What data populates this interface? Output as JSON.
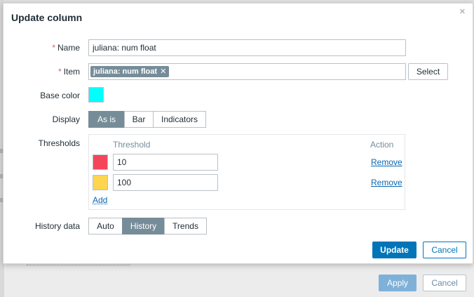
{
  "dialog": {
    "title": "Update column",
    "name_label": "Name",
    "name_value": "juliana: num float",
    "item_label": "Item",
    "item_tag": "juliana: num float",
    "item_tag_remove": "✕",
    "select_button": "Select",
    "base_color_label": "Base color",
    "base_color": "#00FFFF",
    "display_label": "Display",
    "display_options": [
      "As is",
      "Bar",
      "Indicators"
    ],
    "display_selected": "As is",
    "thresholds_label": "Thresholds",
    "thresholds": {
      "col_threshold": "Threshold",
      "col_action": "Action",
      "rows": [
        {
          "color": "#F4455B",
          "value": "10",
          "action": "Remove"
        },
        {
          "color": "#FFD54F",
          "value": "100",
          "action": "Remove"
        }
      ],
      "add_label": "Add"
    },
    "history_label": "History data",
    "history_options": [
      "Auto",
      "History",
      "Trends"
    ],
    "history_selected": "History",
    "update_button": "Update",
    "cancel_button": "Cancel",
    "close_icon": "×"
  },
  "background": {
    "apply_button": "Apply",
    "cancel_button": "Cancel"
  },
  "colors": {
    "primary": "#0275B8",
    "segment_active": "#768D99",
    "required": "#E45959"
  }
}
